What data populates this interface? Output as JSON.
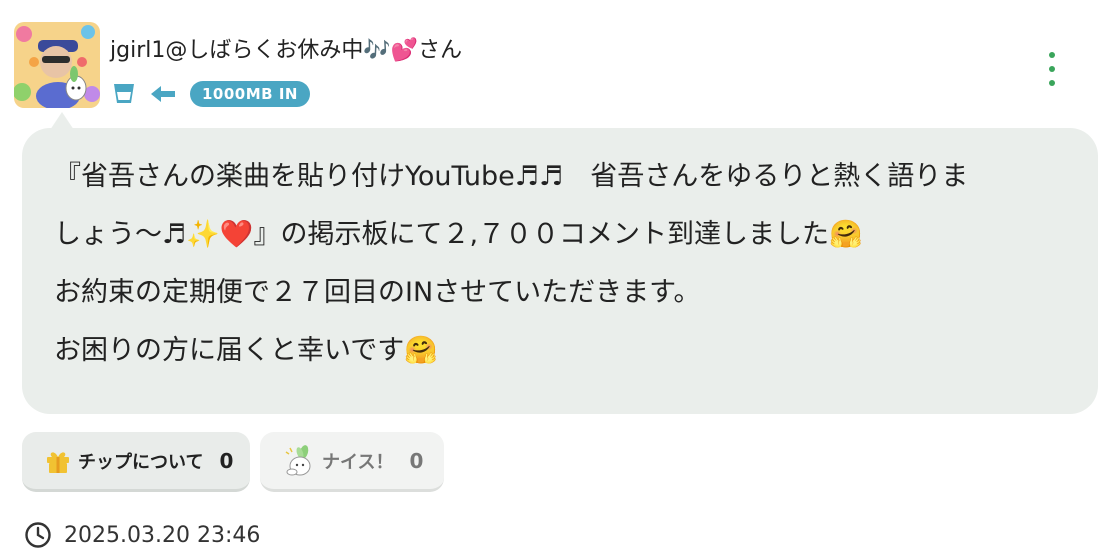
{
  "header": {
    "username": "jgirl1@しばらくお休み中🎶💕さん",
    "badge": "1000MB IN",
    "icons": {
      "cup": "cup-icon",
      "arrow": "arrow-left-icon",
      "menu": "more-vertical-icon"
    }
  },
  "post": {
    "lines": [
      "『省吾さんの楽曲を貼り付けYouTube♬♬　省吾さんをゆるりと熱く語りま",
      "しょう〜♬✨❤️』の掲示板にて２,７００コメント到達しました🤗",
      "お約束の定期便で２７回目のINさせていただきます。",
      "お困りの方に届くと幸いです🤗"
    ]
  },
  "actions": {
    "tip_label": "チップについて",
    "tip_count": "0",
    "nice_label": "ナイス！",
    "nice_count": "0"
  },
  "timestamp": "2025.03.20 23:46",
  "colors": {
    "accent_badge": "#4aa6c3",
    "menu_dots": "#3aa55b",
    "bubble_bg": "#eaeeeb"
  }
}
